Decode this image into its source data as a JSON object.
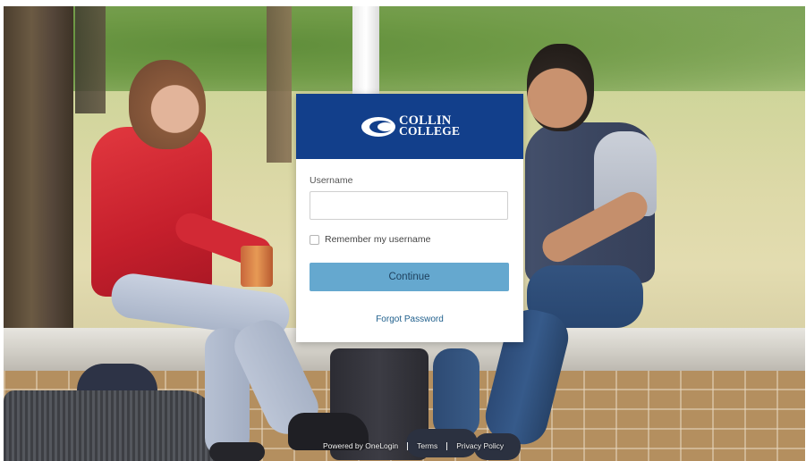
{
  "header": {
    "logo_line1": "COLLIN",
    "logo_line2": "COLLEGE"
  },
  "form": {
    "username_label": "Username",
    "username_value": "",
    "username_placeholder": "",
    "remember_label": "Remember my username",
    "remember_checked": false,
    "continue_label": "Continue",
    "forgot_label": "Forgot Password"
  },
  "footer": {
    "powered_by": "Powered by OneLogin",
    "terms": "Terms",
    "privacy": "Privacy Policy"
  },
  "colors": {
    "header_bg": "#123f8b",
    "button_bg": "#65a8cf",
    "link": "#1f5f8c"
  }
}
